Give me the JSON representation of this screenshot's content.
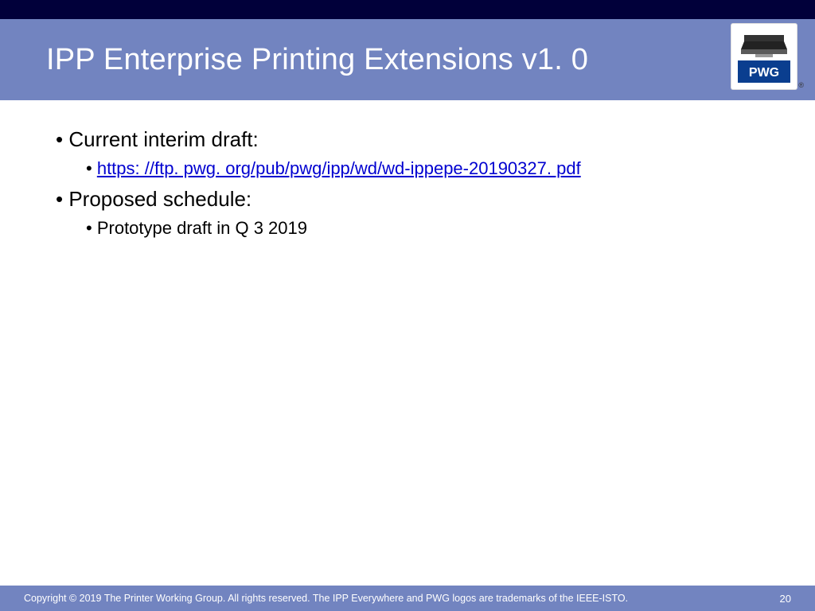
{
  "header": {
    "title": "IPP Enterprise Printing Extensions v1. 0",
    "logo_text": "PWG",
    "registered": "®"
  },
  "body": {
    "items": [
      {
        "text": "Current interim draft:",
        "sub": [
          {
            "text": "https: //ftp. pwg. org/pub/pwg/ipp/wd/wd-ippepe-20190327. pdf"
          }
        ]
      },
      {
        "text": "Proposed schedule:",
        "sub": [
          {
            "text": "Prototype draft in Q 3 2019"
          }
        ]
      }
    ]
  },
  "footer": {
    "copyright": "Copyright © 2019 The Printer Working Group. All rights reserved. The IPP Everywhere and PWG logos are trademarks of the IEEE-ISTO.",
    "page": "20"
  },
  "colors": {
    "accent_dark": "#01003a",
    "accent": "#7284c0",
    "link": "#0000d0",
    "logo_blue": "#0a3e8f"
  }
}
